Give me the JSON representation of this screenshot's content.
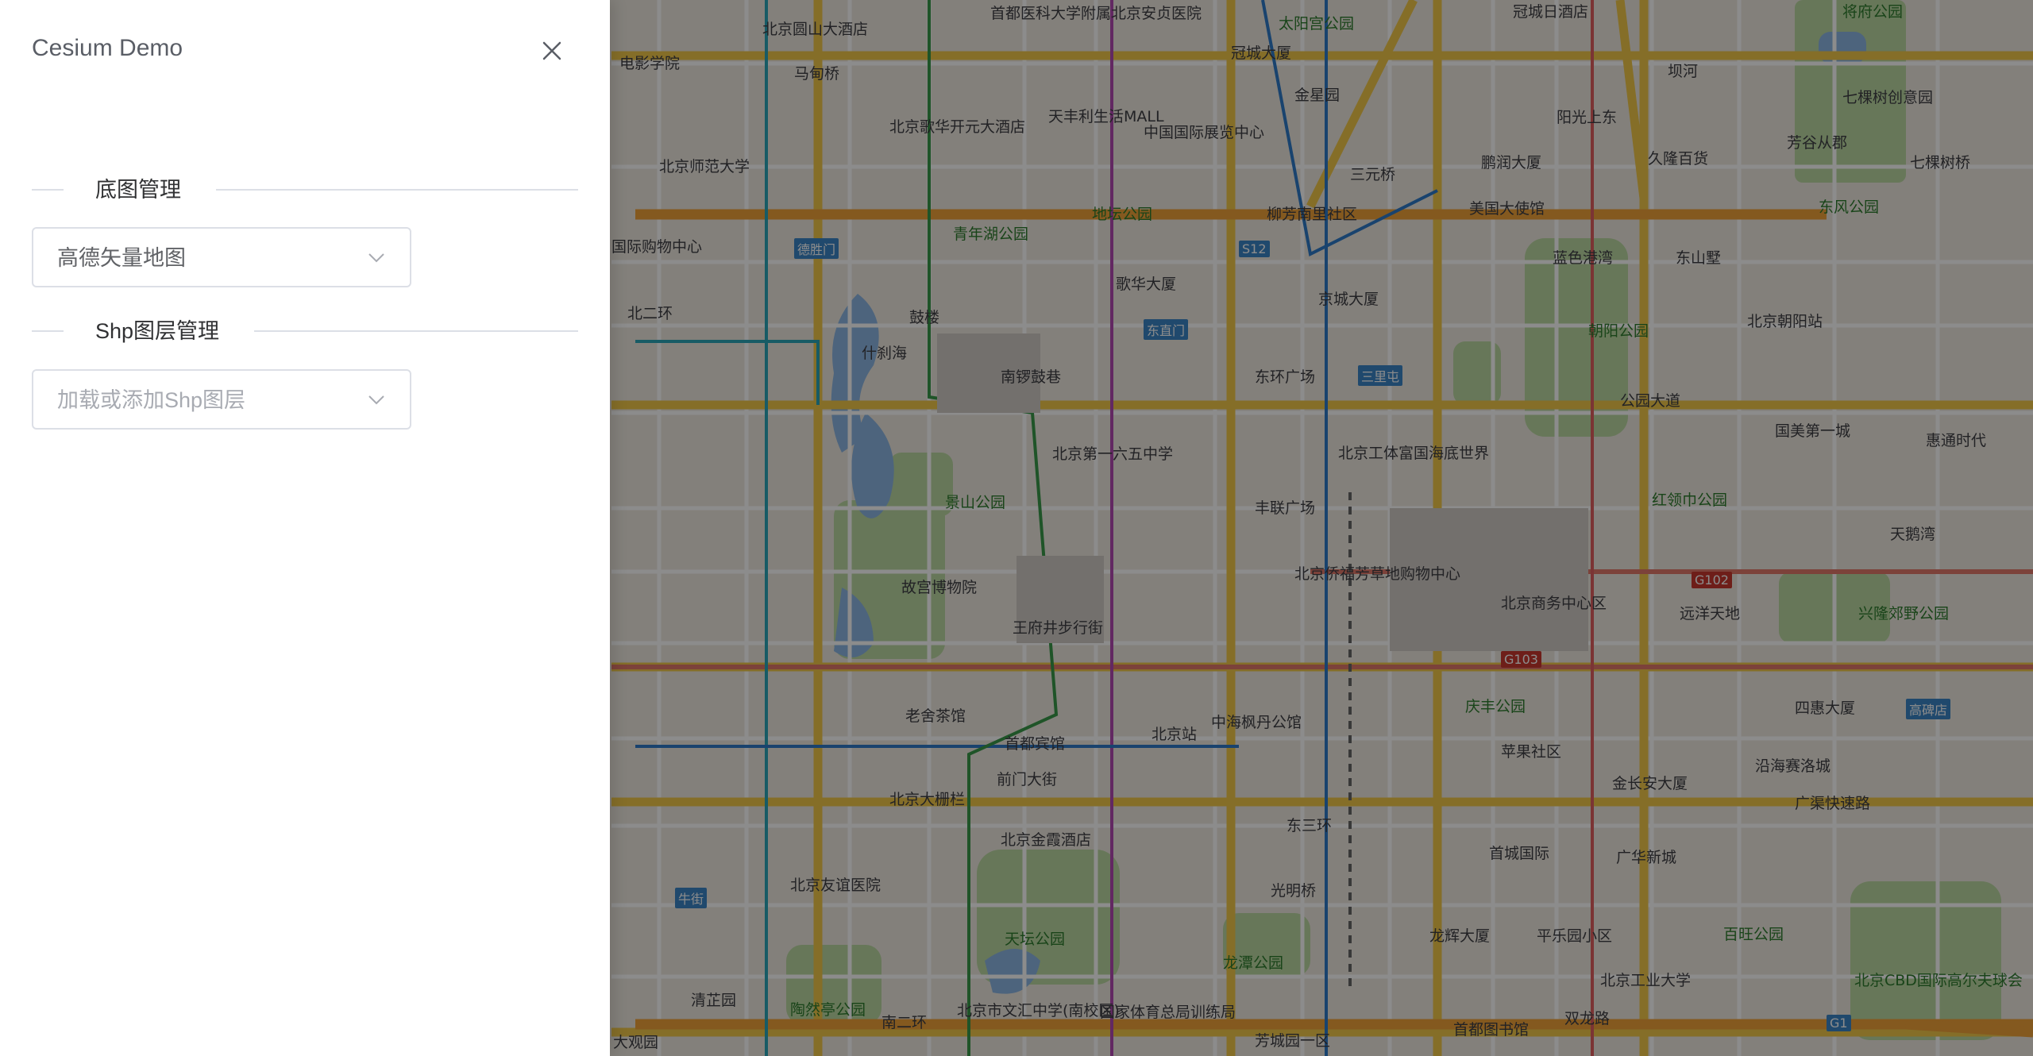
{
  "drawer": {
    "title": "Cesium Demo",
    "sections": [
      {
        "label": "底图管理",
        "select_value": "高德矢量地图",
        "is_placeholder": false
      },
      {
        "label": "Shp图层管理",
        "select_value": "加载或添加Shp图层",
        "is_placeholder": true
      }
    ]
  },
  "map": {
    "labels": [
      {
        "text": "北京圆山大酒店",
        "type": "poi"
      },
      {
        "text": "首都医科大学附属北京安贞医院",
        "type": "poi"
      },
      {
        "text": "太阳宫公园",
        "type": "green"
      },
      {
        "text": "冠城大厦",
        "type": "poi"
      },
      {
        "text": "冠城日酒店",
        "type": "poi"
      },
      {
        "text": "将府公园",
        "type": "green"
      },
      {
        "text": "电影学院",
        "type": "poi"
      },
      {
        "text": "马甸桥",
        "type": "poi"
      },
      {
        "text": "金星园",
        "type": "poi"
      },
      {
        "text": "坝河",
        "type": "poi"
      },
      {
        "text": "七棵树创意园",
        "type": "poi"
      },
      {
        "text": "北京歌华开元大酒店",
        "type": "poi"
      },
      {
        "text": "天丰利生活MALL",
        "type": "poi"
      },
      {
        "text": "中国国际展览中心",
        "type": "poi"
      },
      {
        "text": "阳光上东",
        "type": "poi"
      },
      {
        "text": "芳谷从郡",
        "type": "poi"
      },
      {
        "text": "北京师范大学",
        "type": "poi"
      },
      {
        "text": "三元桥",
        "type": "poi"
      },
      {
        "text": "鹏润大厦",
        "type": "poi"
      },
      {
        "text": "久隆百货",
        "type": "poi"
      },
      {
        "text": "七棵树桥",
        "type": "poi"
      },
      {
        "text": "地坛公园",
        "type": "green"
      },
      {
        "text": "柳芳南里社区",
        "type": "poi"
      },
      {
        "text": "美国大使馆",
        "type": "poi"
      },
      {
        "text": "东风公园",
        "type": "green"
      },
      {
        "text": "青年湖公园",
        "type": "green"
      },
      {
        "text": "国际购物中心",
        "type": "poi"
      },
      {
        "text": "德胜门",
        "type": "road"
      },
      {
        "text": "S12",
        "type": "road"
      },
      {
        "text": "蓝色港湾",
        "type": "poi"
      },
      {
        "text": "东山墅",
        "type": "poi"
      },
      {
        "text": "歌华大厦",
        "type": "poi"
      },
      {
        "text": "京城大厦",
        "type": "poi"
      },
      {
        "text": "鼓楼",
        "type": "poi"
      },
      {
        "text": "朝阳公园",
        "type": "green"
      },
      {
        "text": "北京朝阳站",
        "type": "poi"
      },
      {
        "text": "东直门",
        "type": "road"
      },
      {
        "text": "什刹海",
        "type": "poi"
      },
      {
        "text": "南锣鼓巷",
        "type": "poi"
      },
      {
        "text": "东环广场",
        "type": "poi"
      },
      {
        "text": "三里屯",
        "type": "road"
      },
      {
        "text": "公园大道",
        "type": "poi"
      },
      {
        "text": "北京第一六五中学",
        "type": "poi"
      },
      {
        "text": "北京工体富国海底世界",
        "type": "poi"
      },
      {
        "text": "国美第一城",
        "type": "poi"
      },
      {
        "text": "惠通时代",
        "type": "poi"
      },
      {
        "text": "景山公园",
        "type": "green"
      },
      {
        "text": "丰联广场",
        "type": "poi"
      },
      {
        "text": "红领巾公园",
        "type": "green"
      },
      {
        "text": "天鹅湾",
        "type": "poi"
      },
      {
        "text": "故宫博物院",
        "type": "poi"
      },
      {
        "text": "北京侨福芳草地购物中心",
        "type": "poi"
      },
      {
        "text": "G102",
        "type": "road-red"
      },
      {
        "text": "王府井步行街",
        "type": "poi"
      },
      {
        "text": "北京商务中心区",
        "type": "poi"
      },
      {
        "text": "远洋天地",
        "type": "poi"
      },
      {
        "text": "兴隆郊野公园",
        "type": "green"
      },
      {
        "text": "G103",
        "type": "road-red"
      },
      {
        "text": "庆丰公园",
        "type": "green"
      },
      {
        "text": "四惠大厦",
        "type": "poi"
      },
      {
        "text": "高碑店",
        "type": "road"
      },
      {
        "text": "老舍茶馆",
        "type": "poi"
      },
      {
        "text": "首都宾馆",
        "type": "poi"
      },
      {
        "text": "北京站",
        "type": "poi"
      },
      {
        "text": "中海枫丹公馆",
        "type": "poi"
      },
      {
        "text": "苹果社区",
        "type": "poi"
      },
      {
        "text": "金长安大厦",
        "type": "poi"
      },
      {
        "text": "沿海赛洛城",
        "type": "poi"
      },
      {
        "text": "前门大街",
        "type": "poi"
      },
      {
        "text": "北京大栅栏",
        "type": "poi"
      },
      {
        "text": "广渠快速路",
        "type": "poi"
      },
      {
        "text": "北京金霞酒店",
        "type": "poi"
      },
      {
        "text": "首城国际",
        "type": "poi"
      },
      {
        "text": "广华新城",
        "type": "poi"
      },
      {
        "text": "牛街",
        "type": "road"
      },
      {
        "text": "北京友谊医院",
        "type": "poi"
      },
      {
        "text": "光明桥",
        "type": "poi"
      },
      {
        "text": "天坛公园",
        "type": "green"
      },
      {
        "text": "龙潭公园",
        "type": "green"
      },
      {
        "text": "龙辉大厦",
        "type": "poi"
      },
      {
        "text": "平乐园小区",
        "type": "poi"
      },
      {
        "text": "百旺公园",
        "type": "green"
      },
      {
        "text": "北京CBD国际高尔夫球会",
        "type": "green"
      },
      {
        "text": "清芷园",
        "type": "poi"
      },
      {
        "text": "陶然亭公园",
        "type": "green"
      },
      {
        "text": "北京市文汇中学(南校区)",
        "type": "poi"
      },
      {
        "text": "国家体育总局训练局",
        "type": "poi"
      },
      {
        "text": "北京工业大学",
        "type": "poi"
      },
      {
        "text": "芳城园一区",
        "type": "poi"
      },
      {
        "text": "首都图书馆",
        "type": "poi"
      },
      {
        "text": "双龙路",
        "type": "poi"
      },
      {
        "text": "大观园",
        "type": "poi"
      },
      {
        "text": "北二环",
        "type": "poi"
      },
      {
        "text": "东三环",
        "type": "poi"
      },
      {
        "text": "南二环",
        "type": "poi"
      },
      {
        "text": "G1",
        "type": "road"
      }
    ]
  }
}
